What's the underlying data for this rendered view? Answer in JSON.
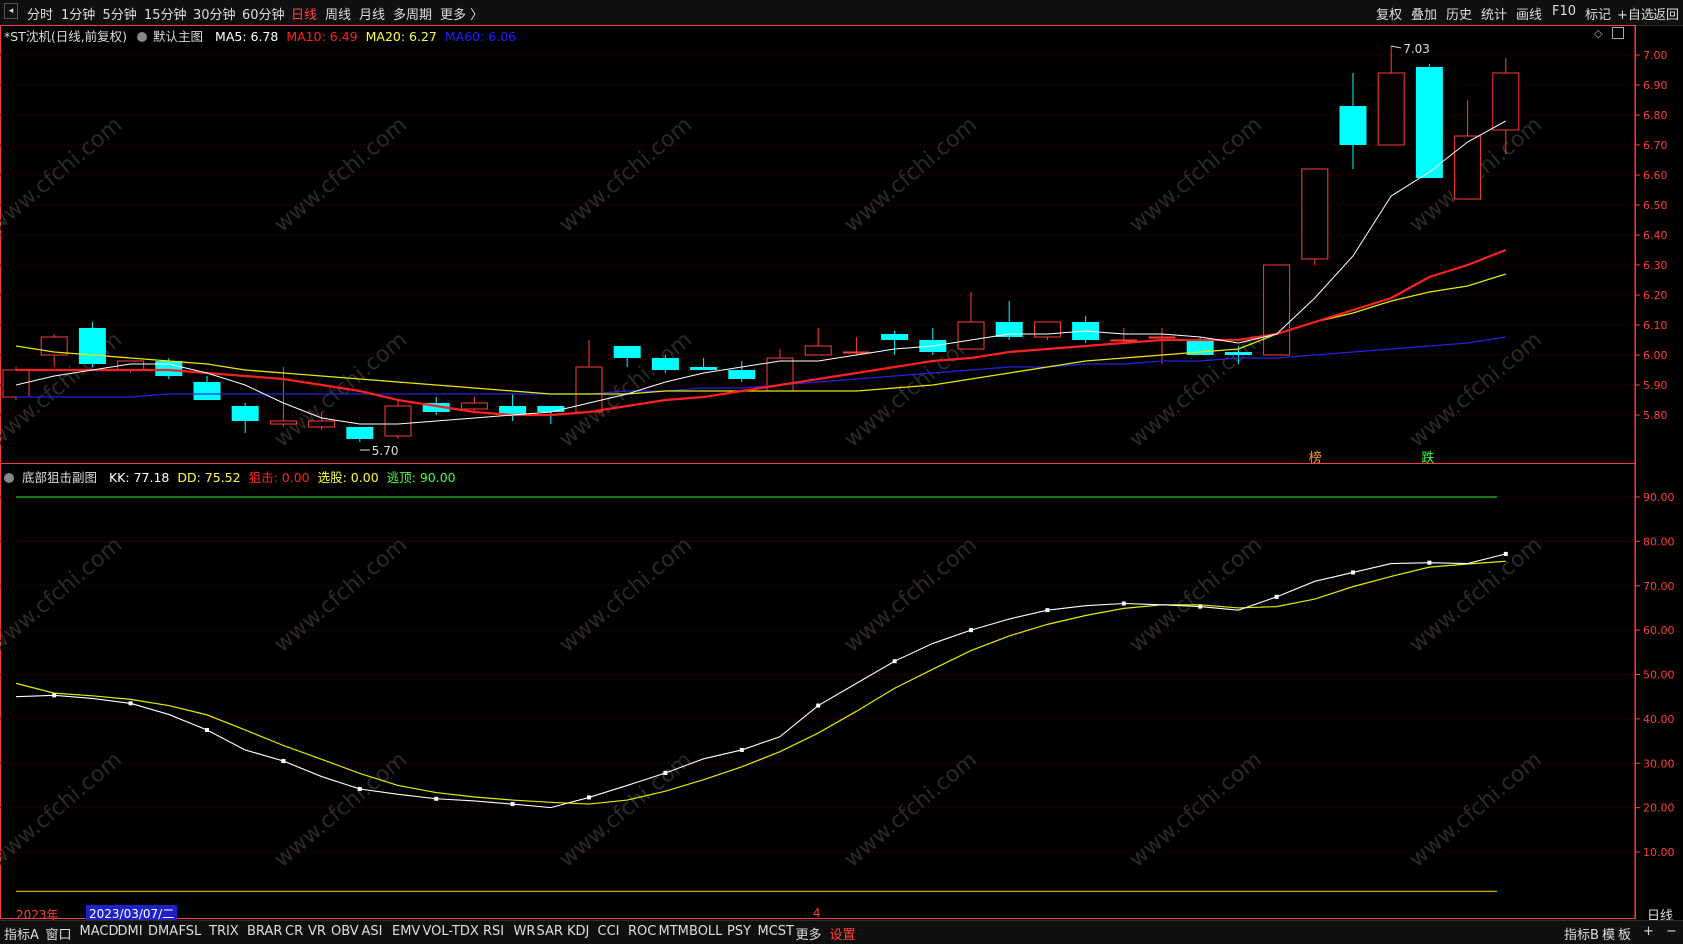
{
  "topbar": {
    "left": [
      "分时",
      "1分钟",
      "5分钟",
      "15分钟",
      "30分钟",
      "60分钟",
      "日线",
      "周线",
      "月线",
      "多周期",
      "更多 〉"
    ],
    "active": "日线",
    "right": [
      "复权",
      "叠加",
      "历史",
      "统计",
      "画线",
      "F10",
      "标记",
      "+自选",
      "返回"
    ]
  },
  "main_header": {
    "stock": "*ST沈机(日线,前复权)",
    "template": "默认主图",
    "ma": [
      {
        "label": "MA5: 6.78",
        "color": "#ffffff"
      },
      {
        "label": "MA10: 6.49",
        "color": "#ff2020"
      },
      {
        "label": "MA20: 6.27",
        "color": "#ffff40"
      },
      {
        "label": "MA60: 6.06",
        "color": "#2020ff"
      }
    ]
  },
  "sub_header": {
    "indicator": "底部狙击副图",
    "values": [
      {
        "label": "KK: 77.18",
        "color": "#ffffff"
      },
      {
        "label": "DD: 75.52",
        "color": "#ffff40"
      },
      {
        "label": "狙击: 0.00",
        "color": "#ff2020"
      },
      {
        "label": "选股: 0.00",
        "color": "#ffff40"
      },
      {
        "label": "逃顶: 90.00",
        "color": "#40ff40"
      }
    ]
  },
  "bottom_labels": {
    "year": "2023年",
    "date": "2023/03/07/二",
    "month": "4",
    "period": "日线"
  },
  "bottombar": {
    "items": [
      "指标A",
      "窗口",
      "MACD",
      "DMI",
      "DMA",
      "FSL",
      "TRIX",
      "BRAR",
      "CR",
      "VR",
      "OBV",
      "ASI",
      "EMV",
      "VOL-TDX",
      "RSI",
      "WR",
      "SAR",
      "KDJ",
      "CCI",
      "ROC",
      "MTM",
      "BOLL",
      "PSY",
      "MCST",
      "更多",
      "设置"
    ],
    "warn": "设置",
    "right": [
      "指标B",
      "模",
      "板",
      "+",
      "−"
    ]
  },
  "colors": {
    "up": "#ff3c3c",
    "down": "#00ffff",
    "ma5": "#ffffff",
    "ma10": "#ff2020",
    "ma20": "#e8e800",
    "ma60": "#2424e0",
    "kk": "#ffffff",
    "dd": "#e8e800",
    "grid": "#5a0000",
    "axis": "#ff3c3c"
  },
  "watermark": "www.cfchi.com",
  "chart_data": [
    {
      "type": "candlestick",
      "ylim": [
        5.7,
        7.05
      ],
      "yticks": [
        "7.00",
        "6.90",
        "6.80",
        "6.70",
        "6.60",
        "6.50",
        "6.40",
        "6.30",
        "6.20",
        "6.10",
        "6.00",
        "5.90",
        "5.80"
      ],
      "annotations": {
        "high": "7.03",
        "low": "5.70",
        "marks": [
          "榜",
          "跌"
        ]
      },
      "candles": [
        {
          "o": 5.86,
          "h": 5.96,
          "l": 5.85,
          "c": 5.95
        },
        {
          "o": 6.0,
          "h": 6.07,
          "l": 5.96,
          "c": 6.06
        },
        {
          "o": 6.09,
          "h": 6.11,
          "l": 5.96,
          "c": 5.97
        },
        {
          "o": 5.95,
          "h": 5.98,
          "l": 5.94,
          "c": 5.98
        },
        {
          "o": 5.98,
          "h": 5.99,
          "l": 5.92,
          "c": 5.93
        },
        {
          "o": 5.91,
          "h": 5.93,
          "l": 5.85,
          "c": 5.85
        },
        {
          "o": 5.83,
          "h": 5.84,
          "l": 5.74,
          "c": 5.78
        },
        {
          "o": 5.77,
          "h": 5.96,
          "l": 5.76,
          "c": 5.78
        },
        {
          "o": 5.76,
          "h": 5.81,
          "l": 5.75,
          "c": 5.78
        },
        {
          "o": 5.76,
          "h": 5.76,
          "l": 5.71,
          "c": 5.72
        },
        {
          "o": 5.73,
          "h": 5.85,
          "l": 5.72,
          "c": 5.83
        },
        {
          "o": 5.84,
          "h": 5.86,
          "l": 5.8,
          "c": 5.81
        },
        {
          "o": 5.82,
          "h": 5.86,
          "l": 5.81,
          "c": 5.84
        },
        {
          "o": 5.83,
          "h": 5.87,
          "l": 5.78,
          "c": 5.8
        },
        {
          "o": 5.83,
          "h": 5.83,
          "l": 5.77,
          "c": 5.81
        },
        {
          "o": 5.81,
          "h": 6.05,
          "l": 5.81,
          "c": 5.96
        },
        {
          "o": 6.03,
          "h": 6.03,
          "l": 5.96,
          "c": 5.99
        },
        {
          "o": 5.99,
          "h": 6.0,
          "l": 5.94,
          "c": 5.95
        },
        {
          "o": 5.96,
          "h": 5.99,
          "l": 5.95,
          "c": 5.95
        },
        {
          "o": 5.95,
          "h": 5.98,
          "l": 5.91,
          "c": 5.92
        },
        {
          "o": 5.88,
          "h": 6.02,
          "l": 5.88,
          "c": 5.99
        },
        {
          "o": 6.0,
          "h": 6.09,
          "l": 6.0,
          "c": 6.03
        },
        {
          "o": 6.01,
          "h": 6.06,
          "l": 6.0,
          "c": 6.01
        },
        {
          "o": 6.07,
          "h": 6.08,
          "l": 6.0,
          "c": 6.05
        },
        {
          "o": 6.05,
          "h": 6.09,
          "l": 6.0,
          "c": 6.01
        },
        {
          "o": 6.02,
          "h": 6.21,
          "l": 6.02,
          "c": 6.11
        },
        {
          "o": 6.11,
          "h": 6.18,
          "l": 6.05,
          "c": 6.06
        },
        {
          "o": 6.06,
          "h": 6.11,
          "l": 6.05,
          "c": 6.11
        },
        {
          "o": 6.11,
          "h": 6.13,
          "l": 6.04,
          "c": 6.05
        },
        {
          "o": 6.05,
          "h": 6.09,
          "l": 6.04,
          "c": 6.05
        },
        {
          "o": 6.06,
          "h": 6.09,
          "l": 5.97,
          "c": 6.06
        },
        {
          "o": 6.05,
          "h": 6.06,
          "l": 6.0,
          "c": 6.0
        },
        {
          "o": 6.01,
          "h": 6.03,
          "l": 5.97,
          "c": 6.0
        },
        {
          "o": 6.0,
          "h": 6.3,
          "l": 6.0,
          "c": 6.3
        },
        {
          "o": 6.32,
          "h": 6.62,
          "l": 6.3,
          "c": 6.62
        },
        {
          "o": 6.83,
          "h": 6.94,
          "l": 6.62,
          "c": 6.7
        },
        {
          "o": 6.7,
          "h": 7.03,
          "l": 6.7,
          "c": 6.94
        },
        {
          "o": 6.96,
          "h": 6.97,
          "l": 6.59,
          "c": 6.59
        },
        {
          "o": 6.52,
          "h": 6.85,
          "l": 6.52,
          "c": 6.73
        },
        {
          "o": 6.75,
          "h": 6.99,
          "l": 6.67,
          "c": 6.94
        }
      ],
      "ma5": [
        5.9,
        5.93,
        5.95,
        5.97,
        5.97,
        5.94,
        5.9,
        5.84,
        5.79,
        5.77,
        5.77,
        5.78,
        5.79,
        5.8,
        5.81,
        5.84,
        5.87,
        5.91,
        5.94,
        5.96,
        5.98,
        5.98,
        6.0,
        6.02,
        6.03,
        6.05,
        6.07,
        6.07,
        6.08,
        6.07,
        6.07,
        6.06,
        6.04,
        6.07,
        6.19,
        6.33,
        6.53,
        6.61,
        6.71,
        6.78
      ],
      "ma10": [
        5.95,
        5.95,
        5.95,
        5.95,
        5.95,
        5.94,
        5.93,
        5.92,
        5.9,
        5.88,
        5.85,
        5.83,
        5.81,
        5.8,
        5.8,
        5.81,
        5.83,
        5.85,
        5.86,
        5.88,
        5.9,
        5.92,
        5.94,
        5.96,
        5.98,
        5.99,
        6.01,
        6.02,
        6.03,
        6.04,
        6.05,
        6.05,
        6.05,
        6.07,
        6.11,
        6.15,
        6.19,
        6.26,
        6.3,
        6.35,
        6.42,
        6.49
      ],
      "ma20": [
        6.03,
        6.01,
        6.0,
        5.99,
        5.98,
        5.97,
        5.95,
        5.94,
        5.93,
        5.92,
        5.91,
        5.9,
        5.89,
        5.88,
        5.87,
        5.87,
        5.87,
        5.88,
        5.88,
        5.88,
        5.88,
        5.88,
        5.88,
        5.89,
        5.9,
        5.92,
        5.94,
        5.96,
        5.98,
        5.99,
        6.0,
        6.01,
        6.02,
        6.07,
        6.11,
        6.14,
        6.18,
        6.21,
        6.23,
        6.27
      ],
      "ma60": [
        5.86,
        5.86,
        5.86,
        5.86,
        5.87,
        5.87,
        5.87,
        5.87,
        5.87,
        5.87,
        5.87,
        5.87,
        5.87,
        5.87,
        5.87,
        5.87,
        5.88,
        5.88,
        5.89,
        5.89,
        5.9,
        5.91,
        5.92,
        5.93,
        5.94,
        5.95,
        5.96,
        5.96,
        5.97,
        5.97,
        5.98,
        5.98,
        5.99,
        5.99,
        6.0,
        6.01,
        6.02,
        6.03,
        6.04,
        6.06
      ]
    },
    {
      "type": "line",
      "ylim": [
        0,
        100
      ],
      "yticks": [
        "90.00",
        "80.00",
        "70.00",
        "60.00",
        "50.00",
        "40.00",
        "30.00",
        "20.00",
        "10.00"
      ],
      "series": [
        {
          "name": "KK",
          "values": [
            45,
            45.3,
            44.6,
            43.5,
            41,
            37.5,
            33,
            30.5,
            27,
            24.2,
            23,
            22,
            21.5,
            20.8,
            20,
            22.3,
            25,
            27.8,
            31,
            33,
            36,
            43,
            48,
            53,
            57,
            60,
            62.5,
            64.5,
            65.5,
            66,
            65.7,
            65.3,
            64.5,
            67.5,
            71,
            73,
            75,
            75.2,
            75,
            77.18
          ]
        },
        {
          "name": "DD",
          "values": [
            48,
            45.8,
            45.2,
            44.4,
            43,
            40.9,
            37.5,
            34,
            30.9,
            27.7,
            25,
            23.4,
            22.4,
            21.7,
            21.2,
            20.8,
            21.7,
            23.7,
            26.3,
            29.2,
            32.6,
            36.8,
            41.7,
            46.9,
            51.2,
            55.4,
            58.7,
            61.3,
            63.3,
            64.9,
            65.7,
            65.7,
            65,
            65.3,
            67,
            69.8,
            72.1,
            74.2,
            74.9,
            75.52
          ]
        },
        {
          "name": "逃顶",
          "values": [
            90
          ]
        },
        {
          "name": "选股",
          "values": [
            0
          ]
        }
      ]
    }
  ]
}
